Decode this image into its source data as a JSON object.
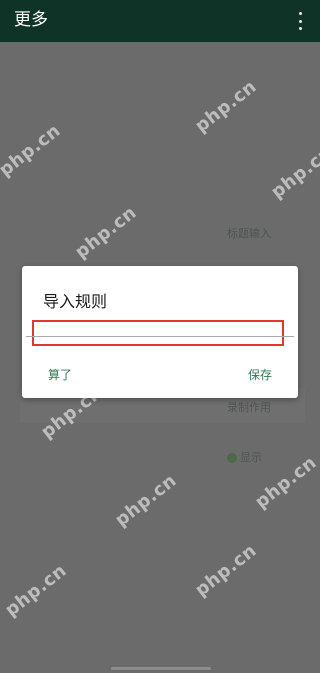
{
  "appbar": {
    "title": "更多",
    "menu_icon": "more-vert-icon",
    "background": "#0f3327"
  },
  "background_content": {
    "item1": "标题输入",
    "item2": "录制作用",
    "record_label": "显示"
  },
  "watermark": "php.cn",
  "dialog": {
    "title": "导入规则",
    "input_value": "",
    "input_placeholder": "",
    "cancel_label": "算了",
    "save_label": "保存",
    "accent_color": "#2f7a56",
    "highlight_color": "#e0382b"
  }
}
